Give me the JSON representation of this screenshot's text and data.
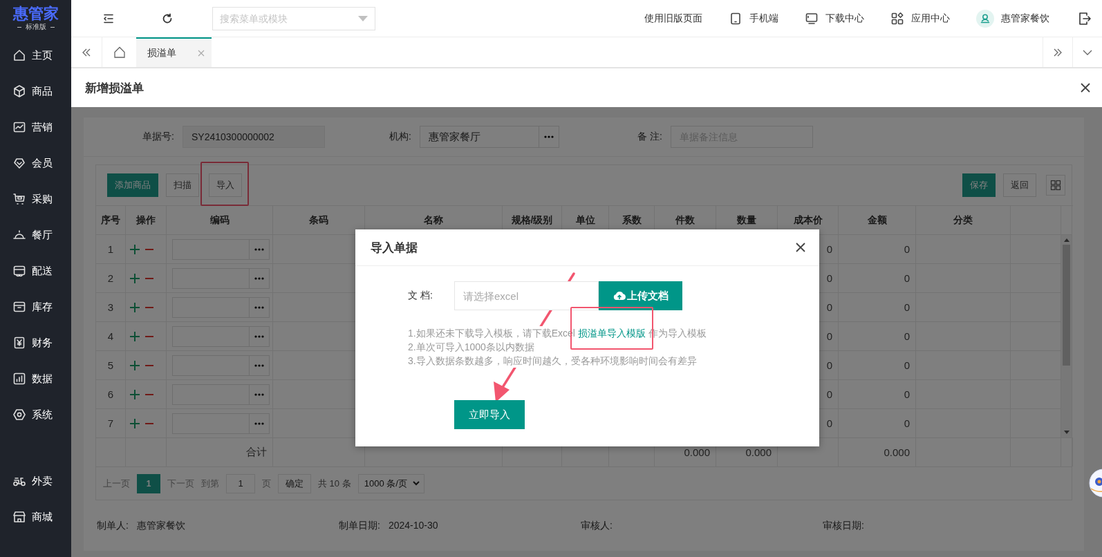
{
  "sidebar": {
    "logo": "惠管家",
    "edition": "标准版",
    "items": [
      {
        "label": "主页",
        "selected": false
      },
      {
        "label": "商品",
        "selected": false
      },
      {
        "label": "营销",
        "selected": false
      },
      {
        "label": "会员",
        "selected": false
      },
      {
        "label": "采购",
        "selected": false
      },
      {
        "label": "餐厅",
        "selected": false
      },
      {
        "label": "配送",
        "selected": false
      },
      {
        "label": "库存",
        "selected": false
      },
      {
        "label": "财务",
        "selected": false
      },
      {
        "label": "数据",
        "selected": false
      },
      {
        "label": "系统",
        "selected": false
      }
    ],
    "bottom_items": [
      {
        "label": "外卖",
        "selected": false
      },
      {
        "label": "商城",
        "selected": false
      }
    ]
  },
  "topbar": {
    "search_placeholder": "搜索菜单或模块",
    "links": [
      "使用旧版页面",
      "手机端",
      "下载中心",
      "应用中心"
    ],
    "user": "惠管家餐饮"
  },
  "tabs": [
    {
      "label": "损溢单",
      "selected": true
    }
  ],
  "page_title": "新增损溢单",
  "form": [
    {
      "kind": "readonly",
      "label": "单据号:",
      "value": "SY2410300000002"
    },
    {
      "kind": "picker",
      "label": "机构:",
      "value": "惠管家餐厅"
    },
    {
      "kind": "text",
      "label": "备 注:",
      "placeholder": "单据备注信息"
    }
  ],
  "toolbar": {
    "left": [
      {
        "label": "添加商品",
        "kind": "primary"
      },
      {
        "label": "扫描",
        "kind": "plain"
      },
      {
        "label": "导入",
        "kind": "plain"
      }
    ],
    "right": [
      {
        "label": "保存",
        "kind": "primary"
      },
      {
        "label": "返回",
        "kind": "plain"
      }
    ]
  },
  "table": {
    "columns": [
      "序号",
      "操作",
      "编码",
      "条码",
      "名称",
      "规格/级别",
      "单位",
      "系数",
      "件数",
      "数量",
      "成本价",
      "金额",
      "分类"
    ],
    "rows": [
      {
        "no": "1",
        "cost_price": "0",
        "amount": "0"
      },
      {
        "no": "2",
        "cost_price": "0",
        "amount": "0"
      },
      {
        "no": "3",
        "cost_price": "0",
        "amount": "0"
      },
      {
        "no": "4",
        "cost_price": "0",
        "amount": "0"
      },
      {
        "no": "5",
        "cost_price": "0",
        "amount": "0"
      },
      {
        "no": "6",
        "cost_price": "0",
        "amount": "0"
      },
      {
        "no": "7",
        "cost_price": "0",
        "amount": "0"
      }
    ],
    "summary": {
      "label": "合计",
      "pieces": "0.000",
      "quantity": "0.000",
      "amount": "0.000"
    }
  },
  "pagination": {
    "prev": {
      "label": "上一页",
      "disabled": true
    },
    "pages": [
      {
        "label": "1",
        "selected": true
      }
    ],
    "next": {
      "label": "下一页",
      "disabled": true
    },
    "goto_label": "到第",
    "goto_value": "1",
    "page_unit": "页",
    "confirm": "确定",
    "total": "共 10 条",
    "page_size": "1000 条/页"
  },
  "footer": [
    {
      "label": "制单人:",
      "value": "惠管家餐饮"
    },
    {
      "label": "制单日期:",
      "value": "2024-10-30"
    },
    {
      "label": "审核人:"
    },
    {
      "label": "审核日期:"
    }
  ],
  "modal": {
    "title": "导入单据",
    "field_label": "文 档:",
    "placeholder": "请选择excel",
    "upload": "上传文档",
    "notes": [
      {
        "before": "1.如果还未下载导入模板，请下载Excel ",
        "link": "损溢单导入模版",
        "after": " 作为导入模板"
      },
      {
        "before": "2.单次可导入1000条以内数据"
      },
      {
        "before": "3.导入数据条数越多，响应时间越久，受各种环境影响时间会有差异"
      }
    ],
    "submit": "立即导入"
  }
}
